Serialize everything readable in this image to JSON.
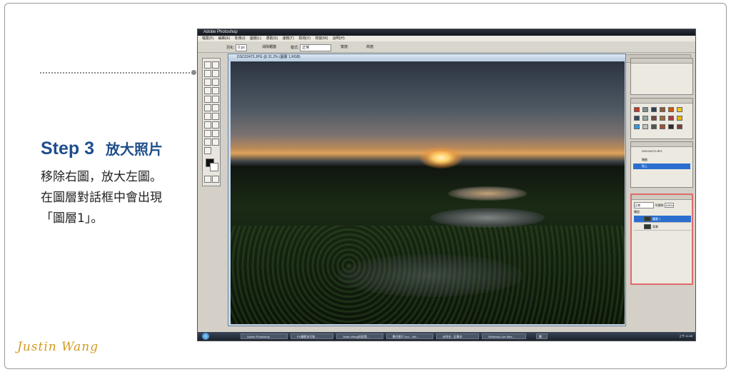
{
  "step": {
    "number": "Step 3",
    "title": "放大照片"
  },
  "description": [
    "移除右圖，放大左圖。",
    "在圖層對話框中會出現",
    "「圖層1」。"
  ],
  "signature": "Justin Wang",
  "app": {
    "window_title": "Adobe Photoshop",
    "menu": [
      "檔案(F)",
      "編輯(E)",
      "影像(I)",
      "圖層(L)",
      "選取(S)",
      "濾鏡(T)",
      "檢視(V)",
      "視窗(W)",
      "說明(H)"
    ],
    "options": {
      "feather_label": "羽化:",
      "feather_value": "0 px",
      "antialias_label": "消除鋸齒",
      "style_label": "樣式:",
      "style_value": "正常",
      "width_label": "寬度:",
      "height_label": "高度:"
    },
    "document_title": "DSC02473.JPG @ 31.2% (圖層 1,RGB)",
    "history": {
      "snapshot": "DSC02473.JPG",
      "items": [
        "開啟",
        "貼上"
      ]
    },
    "layers": {
      "blend": "正常",
      "opacity_label": "不透明:",
      "opacity_value": "100%",
      "lock_label": "鎖定:",
      "items": [
        "圖層 1",
        "背景"
      ]
    },
    "taskbar": {
      "items": [
        "Adobe Photoshop",
        "PS攝影技巧和...",
        "Justin Wang的部落...",
        "數位影片.doc - Mic...",
        "未命名 - 記事本",
        "Windows Live Mes..."
      ],
      "ime": "繁",
      "clock": "上午 11:49"
    }
  }
}
